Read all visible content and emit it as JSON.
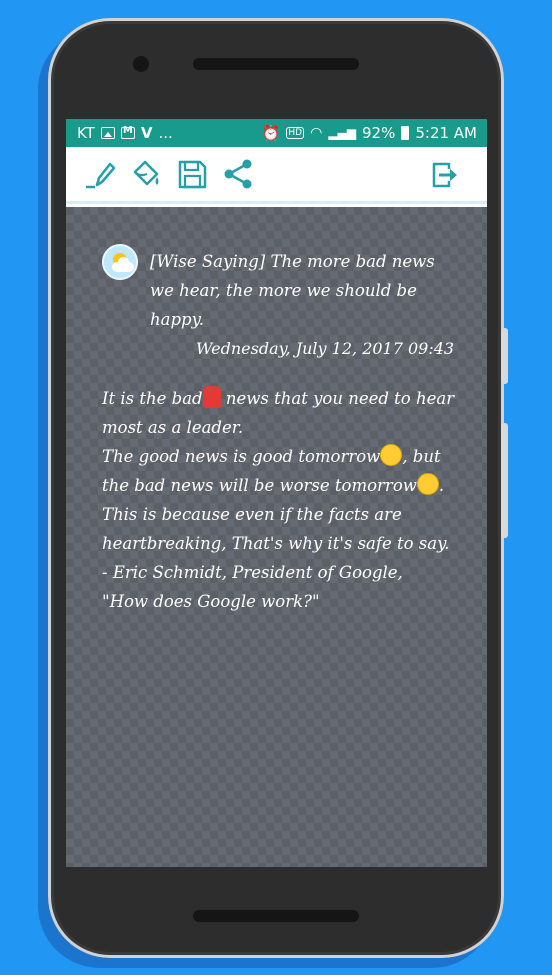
{
  "status_bar": {
    "carrier": "KT",
    "left_extra": "...",
    "battery": "92%",
    "time": "5:21 AM",
    "hd_label": "HD"
  },
  "toolbar": {
    "icons": [
      "edit-icon",
      "paint-bucket-icon",
      "save-icon",
      "share-icon",
      "exit-icon"
    ],
    "accent": "#26a0a8"
  },
  "entry": {
    "saying": "[Wise Saying] The more bad news we hear, the more we should be happy.",
    "date": "Wednesday, July 12, 2017 09:43",
    "body": {
      "l1a": "It is the bad",
      "l1b": " news that you need to hear most as a leader.",
      "l2a": "The good news is good tomorrow",
      "l2b": ", but the bad news will be worse tomorrow",
      "l2c": ".",
      "l3": "This is because even if the facts are heartbreaking, That's why it's safe to say.",
      "l4": "- Eric Schmidt, President of Google,",
      "l5": "\"How does Google work?\""
    }
  }
}
